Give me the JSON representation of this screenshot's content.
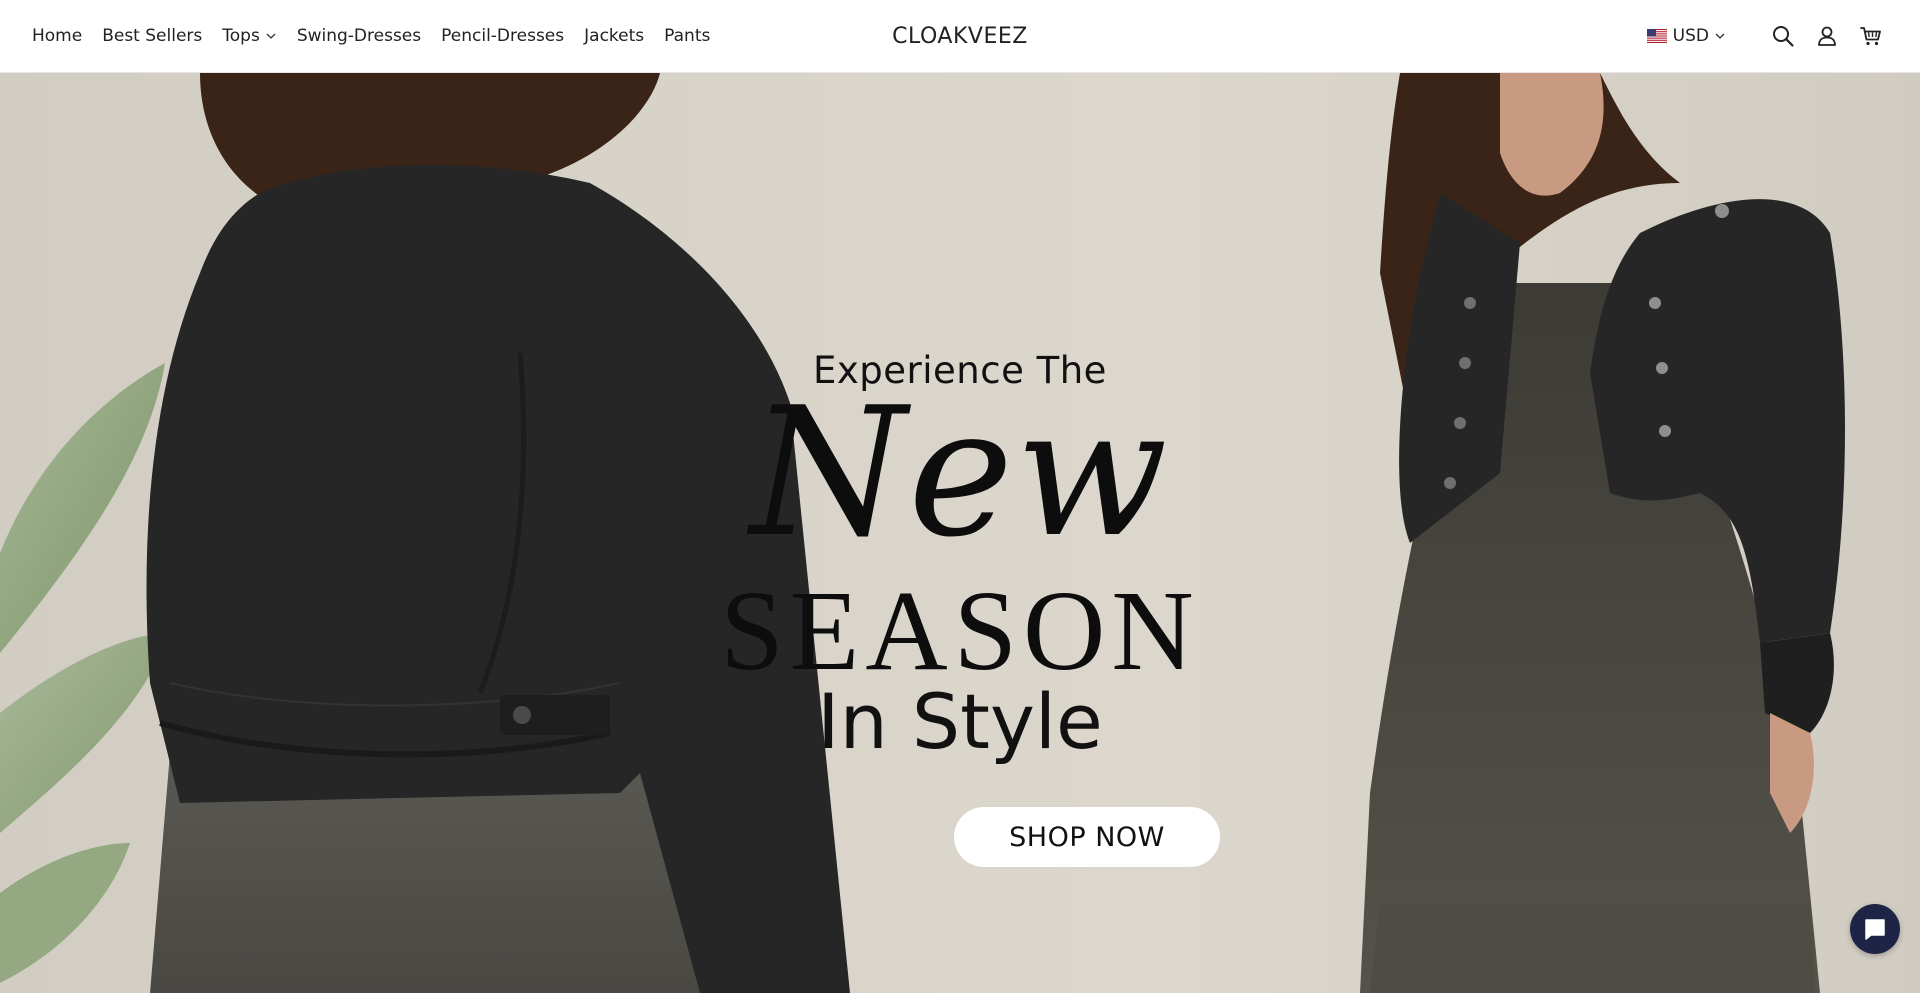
{
  "header": {
    "nav": [
      {
        "label": "Home"
      },
      {
        "label": "Best Sellers"
      },
      {
        "label": "Tops",
        "has_dropdown": true
      },
      {
        "label": "Swing-Dresses"
      },
      {
        "label": "Pencil-Dresses"
      },
      {
        "label": "Jackets"
      },
      {
        "label": "Pants"
      }
    ],
    "logo": "CLOAKVEEZ",
    "currency": {
      "label": "USD",
      "flag": "us-flag-icon"
    },
    "icons": [
      "search-icon",
      "account-icon",
      "cart-icon"
    ]
  },
  "hero": {
    "line1": "Experience The",
    "line2": "New",
    "line3": "SEASON",
    "line4": "In Style",
    "cta_label": "SHOP NOW"
  },
  "chat": {
    "icon": "chat-icon",
    "color": "#1d2445"
  },
  "colors": {
    "hero_background": "#d9d4ca",
    "text": "#111111",
    "button_bg": "#ffffff"
  }
}
